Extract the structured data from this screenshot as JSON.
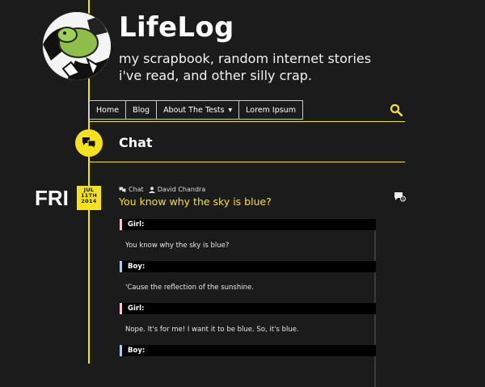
{
  "header": {
    "title": "LifeLog",
    "description": "my scrapbook, random internet stories i've read, and other silly crap."
  },
  "nav": {
    "items": [
      {
        "label": "Home"
      },
      {
        "label": "Blog"
      },
      {
        "label": "About The Tests"
      },
      {
        "label": "Lorem Ipsum"
      }
    ]
  },
  "section": {
    "title": "Chat"
  },
  "post": {
    "day": "FRI",
    "month": "JUL",
    "date": "11TH",
    "year": "2014",
    "format": "Chat",
    "author": "David Chandra",
    "title": "You know why the sky is blue?",
    "chat": [
      {
        "speaker": "Girl:",
        "line": "You know why the sky is blue?"
      },
      {
        "speaker": "Boy:",
        "line": "'Cause the reflection of the sunshine."
      },
      {
        "speaker": "Girl:",
        "line": "Nope. It's for me! I want it to be blue. So, it's blue."
      },
      {
        "speaker": "Boy:",
        "line": ""
      }
    ]
  },
  "colors": {
    "accent": "#f3e21d",
    "background": "#1b1b1b",
    "girl": "#f7c6c6",
    "boy": "#a9cce9"
  }
}
